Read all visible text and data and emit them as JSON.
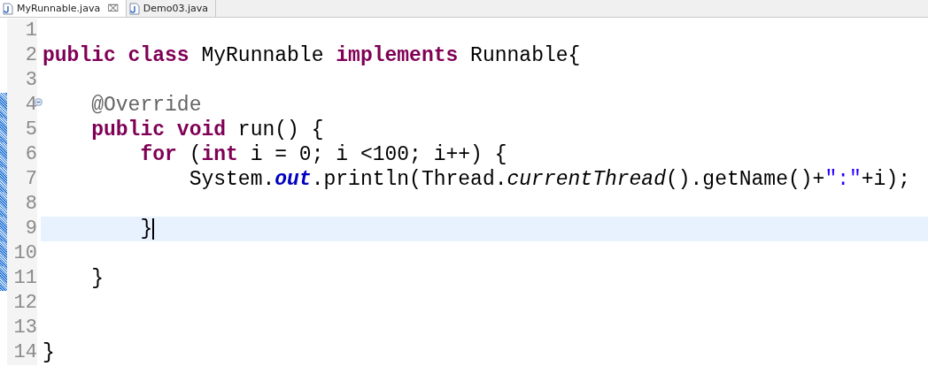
{
  "tabs": [
    {
      "label": "MyRunnable.java",
      "selected": true,
      "close": "⌧"
    },
    {
      "label": "Demo03.java",
      "selected": false
    }
  ],
  "lines": [
    {
      "number": "1",
      "changed": false
    },
    {
      "number": "2",
      "changed": false,
      "tokens": [
        {
          "kind": "kw",
          "text": "public class"
        },
        {
          "kind": "plain",
          "text": " MyRunnable "
        },
        {
          "kind": "kw",
          "text": "implements"
        },
        {
          "kind": "plain",
          "text": " Runnable{"
        }
      ]
    },
    {
      "number": "3",
      "changed": false
    },
    {
      "number": "4",
      "changed": true,
      "foldable": true,
      "tokens": [
        {
          "kind": "ann",
          "text": "    @Override"
        }
      ]
    },
    {
      "number": "5",
      "changed": true,
      "tokens": [
        {
          "kind": "kw",
          "text": "    public void"
        },
        {
          "kind": "plain",
          "text": " run() {"
        }
      ]
    },
    {
      "number": "6",
      "changed": true,
      "tokens": [
        {
          "kind": "kw",
          "text": "        for"
        },
        {
          "kind": "plain",
          "text": " ("
        },
        {
          "kind": "kw",
          "text": "int"
        },
        {
          "kind": "plain",
          "text": " i = 0; i <100; i++) {"
        }
      ]
    },
    {
      "number": "7",
      "changed": true,
      "tokens": [
        {
          "kind": "plain",
          "text": "            System."
        },
        {
          "kind": "field",
          "text": "out"
        },
        {
          "kind": "plain",
          "text": ".println(Thread."
        },
        {
          "kind": "static",
          "text": "currentThread"
        },
        {
          "kind": "plain",
          "text": "().getName()+"
        },
        {
          "kind": "str",
          "text": "\":\""
        },
        {
          "kind": "plain",
          "text": "+i);"
        }
      ]
    },
    {
      "number": "8",
      "changed": true
    },
    {
      "number": "9",
      "changed": true,
      "current": true,
      "tokens": [
        {
          "kind": "plain",
          "text": "        }"
        }
      ]
    },
    {
      "number": "10",
      "changed": true
    },
    {
      "number": "11",
      "changed": true,
      "tokens": [
        {
          "kind": "plain",
          "text": "    }"
        }
      ]
    },
    {
      "number": "12",
      "changed": false
    },
    {
      "number": "13",
      "changed": false
    },
    {
      "number": "14",
      "changed": false,
      "tokens": [
        {
          "kind": "plain",
          "text": "}"
        }
      ]
    }
  ]
}
